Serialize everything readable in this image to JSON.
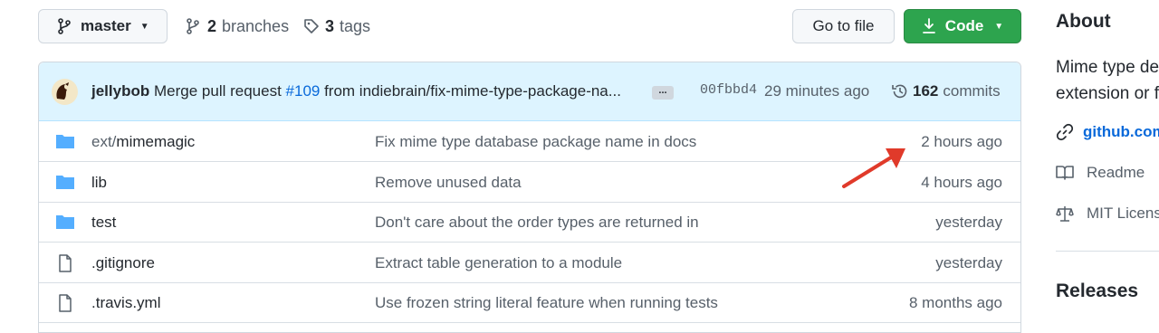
{
  "branch": {
    "label": "master"
  },
  "branches": {
    "count": "2",
    "label": "branches"
  },
  "tags": {
    "count": "3",
    "label": "tags"
  },
  "buttons": {
    "go_to_file": "Go to file",
    "code": "Code"
  },
  "commit": {
    "author": "jellybob",
    "message_prefix": "Merge pull request ",
    "pr": "#109",
    "message_suffix": " from indiebrain/fix-mime-type-package-na...",
    "ellipsis": "...",
    "sha": "00fbbd4",
    "time": "29 minutes ago",
    "count": "162",
    "count_label": "commits"
  },
  "files": [
    {
      "type": "folder",
      "dir": "ext/",
      "name": "mimemagic",
      "message": "Fix mime type database package name in docs",
      "age": "2 hours ago"
    },
    {
      "type": "folder",
      "dir": "",
      "name": "lib",
      "message": "Remove unused data",
      "age": "4 hours ago"
    },
    {
      "type": "folder",
      "dir": "",
      "name": "test",
      "message": "Don't care about the order types are returned in",
      "age": "yesterday"
    },
    {
      "type": "file",
      "dir": "",
      "name": ".gitignore",
      "message": "Extract table generation to a module",
      "age": "yesterday"
    },
    {
      "type": "file",
      "dir": "",
      "name": ".travis.yml",
      "message": "Use frozen string literal feature when running tests",
      "age": "8 months ago"
    }
  ],
  "about": {
    "title": "About",
    "description_line1": "Mime type de",
    "description_line2": "extension or f",
    "link": "github.com",
    "readme": "Readme",
    "license": "MIT Licens"
  },
  "releases": {
    "title": "Releases"
  },
  "colors": {
    "accent": "#0969da",
    "code_button": "#2da44e",
    "arrow": "#e03a2a",
    "folder": "#54aeff"
  }
}
